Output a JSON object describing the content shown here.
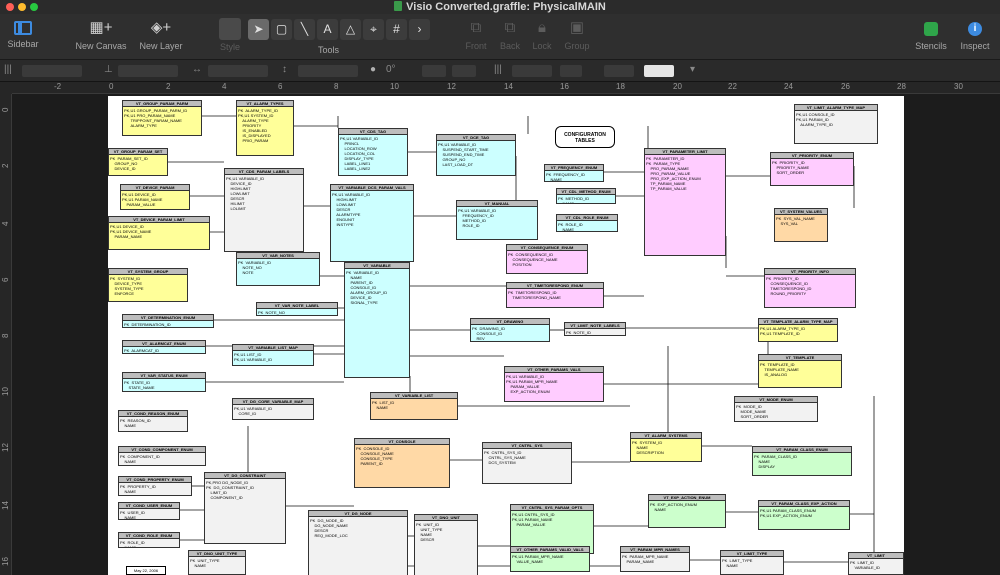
{
  "window": {
    "title": "Visio Converted.graffle: PhysicalMAIN"
  },
  "toolbar": {
    "sidebar": "Sidebar",
    "new_canvas": "New Canvas",
    "new_layer": "New Layer",
    "style": "Style",
    "tools": "Tools",
    "front": "Front",
    "back": "Back",
    "lock": "Lock",
    "group": "Group",
    "stencils": "Stencils",
    "inspect": "Inspect"
  },
  "formatbar": {
    "rotation": "0°"
  },
  "ruler": {
    "h_ticks": [
      "-2",
      "0",
      "2",
      "4",
      "6",
      "8",
      "10",
      "12",
      "14",
      "16",
      "18",
      "20",
      "22",
      "24",
      "26",
      "28",
      "30"
    ],
    "v_ticks": [
      "0",
      "2",
      "4",
      "6",
      "8",
      "10",
      "12",
      "14",
      "16"
    ]
  },
  "canvas": {
    "config_label": "CONFIGURATION TABLES",
    "date_label": "May 22, 2006",
    "tables": [
      {
        "name": "VT_GROUP_PARAM_PARM",
        "color": "yel",
        "rows": "PK,U1 GROUP_PARAM_PARM_ID\nPK,U1 PRO_PARAM_NAME\n      TRIPPOINT_PARAM_NAME\n      ALARM_TYPE"
      },
      {
        "name": "VT_ALARM_TYPES",
        "color": "yel",
        "rows": "PK  ALARM_TYPE_ID\nPK,U1 SYSTEM_ID\n    ALARM_TYPE\n    PRIORITY\n    IS_ENABLED\n    IS_DISPLAYED\n    PRIO_PARAM"
      },
      {
        "name": "VT_CDS_TAG",
        "color": "cyan",
        "rows": "PK,U1 VARIABLE_ID\n    PRINCL\n    LOCATION_ROW\n    LOCATION_COL\n    DISPLAY_TYPE\n    LABEL_LINE1\n    LABEL_LINE2"
      },
      {
        "name": "VT_DCE_TAG",
        "color": "cyan",
        "rows": "PK,U1 VARIABLE_ID\n    SUSPEND_START_TIME\n    SUSPEND_END_TIME\n    GROUP_NO\n    LAST_LOAD_DT"
      },
      {
        "name": "VT_GROUP_PARAM_SET",
        "color": "yel",
        "rows": "PK  PARAM_SET_ID\n    GROUP_NO\n    DEVICE_ID"
      },
      {
        "name": "VT_DEVICE_PARAM",
        "color": "yel",
        "rows": "PK,U1 DEVICE_ID\nPK,U1 PARAM_NAME\n    PARAM_VALUE"
      },
      {
        "name": "VT_CDS_PARAM_LABELS",
        "color": "grey",
        "rows": "PK,U1 VARIABLE_ID\n    DEVICE_ID\n    HIGHLIMIT\n    LOWLIMIT\n    DESCR\n    HILIMIT\n    LOLIMIT"
      },
      {
        "name": "VT_VARIABLE_DCS_PARAM_VALS",
        "color": "cyan",
        "rows": "PK,U1 VARIABLE_ID\n    HIGHLIMIT\n    LOWLIMIT\n    DESCR\n    ALARMTYPE\n    ENGUNIT\n    INSTYPE"
      },
      {
        "name": "VT_PARAMETER_LIMIT",
        "color": "mag",
        "rows": "PK  PARAMETER_ID\nPK  PARAM_TYPE\n    PRO_PARAM_NAME\n    PRO_PARAM_VALUE\n    PRO_EXP_ACTION_ENUM\n    TP_PARAM_NAME\n    TP_PARAM_VALUE"
      },
      {
        "name": "VT_FREQUENCY_ENUM",
        "color": "cyan",
        "rows": "PK  FREQUENCY_ID\n    NAME"
      },
      {
        "name": "VT_CDL_METHOD_ENUM",
        "color": "cyan",
        "rows": "PK  METHOD_ID\n    NAME"
      },
      {
        "name": "VT_MANUAL",
        "color": "cyan",
        "rows": "PK,U1 VARIABLE_ID\n    FREQUENCY_ID\n    METHOD_ID\n    ROLE_ID"
      },
      {
        "name": "VT_CDL_ROLE_ENUM",
        "color": "cyan",
        "rows": "PK  ROLE_ID\n    NAME"
      },
      {
        "name": "VT_PRIORITY_ENUM",
        "color": "mag",
        "rows": "PK  PRIORITY_ID\n    PRIORITY_NAME\n    SORT_ORDER"
      },
      {
        "name": "VT_LIMIT_ALARM_TYPE_MAP",
        "color": "grey",
        "rows": "PK,U1 CONSOLE_ID\nPK,U1 PARAM_ID\n    ALARM_TYPE_ID"
      },
      {
        "name": "VT_SYSTEM_VALUES",
        "color": "org",
        "rows": "PK  SYS_VAL_NAME\n    SYS_VAL"
      },
      {
        "name": "VT_DEVICE_PARAM_LIMIT",
        "color": "yel",
        "rows": "PK,U1 DEVICE_ID\nPK,U1 DEVICE_NAME\n    PARAM_NAME"
      },
      {
        "name": "VT_SYSTEM_GROUP",
        "color": "yel",
        "rows": "PK  SYSTEM_ID\n    DEVICE_TYPE\n    SYSTEM_TYPE\n    ENFORCE"
      },
      {
        "name": "VT_VAR_NOTES",
        "color": "cyan",
        "rows": "PK  VARIABLE_ID\n    NOTE_NO\n    NOTE"
      },
      {
        "name": "VT_VARIABLE",
        "color": "cyan",
        "rows": "PK  VARIABLE_ID\n    NAME\n    PARENT_ID\n    CONSOLE_ID\n    ALARM_GROUP_ID\n    DEVICE_ID\n    SIGNAL_TYPE"
      },
      {
        "name": "VT_CONSEQUENCE_ENUM",
        "color": "mag",
        "rows": "PK  CONSEQUENCE_ID\n    CONSEQUENCE_NAME\n    POSITION"
      },
      {
        "name": "VT_TIMETORESPOND_ENUM",
        "color": "mag",
        "rows": "PK  TIMETORESPOND_ID\n    TIMETORESPOND_NAME"
      },
      {
        "name": "VT_PRIORITY_INFO",
        "color": "mag",
        "rows": "PK  PRIORITY_ID\n    CONSEQUENCE_ID\n    TIMETORESPOND_ID\n    ROUND_PRIORITY"
      },
      {
        "name": "VT_DETERMINATION_ENUM",
        "color": "cyan",
        "rows": "PK  DETERMINATION_ID\n    DETERMINATION"
      },
      {
        "name": "VT_ALARMCAT_ENUM",
        "color": "cyan",
        "rows": "PK  ALARMCAT_ID\n    ALARMCAT"
      },
      {
        "name": "VT_VAR_STATUS_ENUM",
        "color": "cyan",
        "rows": "PK  STATE_ID\n    STATE_NAME"
      },
      {
        "name": "VT_VAR_NOTE_LABEL",
        "color": "cyan",
        "rows": "PK  NOTE_NO\n    NOTE_NAME"
      },
      {
        "name": "VT_VARIABLE_LIST_MAP",
        "color": "cyan",
        "rows": "PK,U1 LIST_ID\nPK,U1 VARIABLE_ID"
      },
      {
        "name": "VT_DRAWING",
        "color": "cyan",
        "rows": "PK  DRAWING_ID\n    CONSOLE_ID\n    REV"
      },
      {
        "name": "VT_LIMIT_NOTE_LABELS",
        "color": "grey",
        "rows": "PK  NOTE_ID\n    NOTE"
      },
      {
        "name": "VT_TEMPLATE_ALARM_TYPE_MAP",
        "color": "yel",
        "rows": "PK,U1 ALARM_TYPE_ID\nPK,U1 TEMPLATE_ID"
      },
      {
        "name": "VT_OTHER_PARAMS_VALS",
        "color": "mag",
        "rows": "PK,U1 VARIABLE_ID\nPK,U1 PARAM_MPR_NAME\n    PARAM_VALUE\n    EXP_ACTION_ENUM"
      },
      {
        "name": "VT_TEMPLATE",
        "color": "yel",
        "rows": "PK  TEMPLATE_ID\n    TEMPLATE_NAME\n    IS_ANALOG"
      },
      {
        "name": "VT_COND_REASON_ENUM",
        "color": "grey",
        "rows": "PK  REASON_ID\n    NAME"
      },
      {
        "name": "VT_DG_CORE_VARIABLE_MAP",
        "color": "grey",
        "rows": "PK,U1 VARIABLE_ID\n    CORE_ID"
      },
      {
        "name": "VT_VARIABLE_LIST",
        "color": "org",
        "rows": "PK  LIST_ID\n    NAME"
      },
      {
        "name": "VT_MODE_ENUM",
        "color": "grey",
        "rows": "PK  MODE_ID\n    MODE_NAME\n    SORT_ORDER"
      },
      {
        "name": "VT_COND_COMPONENT_ENUM",
        "color": "grey",
        "rows": "PK  COMPONENT_ID\n    NAME"
      },
      {
        "name": "VT_CONSOLE",
        "color": "org",
        "rows": "PK  CONSOLE_ID\n    CONSOLE_NAME\n    CONSOLE_TYPE\n    PARENT_ID"
      },
      {
        "name": "VT_CNTRL_SYS",
        "color": "grey",
        "rows": "PK  CNTRL_SYS_ID\n    CNTRL_SYS_NAME\n    DCS_SYSTEM"
      },
      {
        "name": "VT_ALARM_SYSTEMS",
        "color": "yel",
        "rows": "PK  SYSTEM_ID\n    NAME\n    DESCRIPTION"
      },
      {
        "name": "VT_PARAM_CLASS_ENUM",
        "color": "grn",
        "rows": "PK  PARAM_CLASS_ID\n    NAME\n    DISPLAY"
      },
      {
        "name": "VT_COND_PROPERTY_ENUM",
        "color": "grey",
        "rows": "PK  PROPERTY_ID\n    NAME"
      },
      {
        "name": "VT_DG_CONSTRAINT",
        "color": "grey",
        "rows": "PK,PRO DG_NODE_ID\nPK  DG_CONSTRAINT_ID\n    LIMIT_ID\n    COMPONENT_ID"
      },
      {
        "name": "VT_COND_USER_ENUM",
        "color": "grey",
        "rows": "PK  USER_ID\n    NAME"
      },
      {
        "name": "VT_COND_ROLE_ENUM",
        "color": "grey",
        "rows": "PK  ROLE_ID\n    NAME"
      },
      {
        "name": "VT_EXP_ACTION_ENUM",
        "color": "grn",
        "rows": "PK  EXP_ACTION_ENUM\n    NAME"
      },
      {
        "name": "VT_PARAM_CLASS_EXP_ACTION",
        "color": "grn",
        "rows": "PK,U1 PARAM_CLASS_ENUM\nPK,U1 EXP_ACTION_ENUM"
      },
      {
        "name": "VT_DG_NODE",
        "color": "grey",
        "rows": "PK  DG_NODE_ID\n    DG_NODE_NAME\n    DESCR\n    REQ_MODE_LOC"
      },
      {
        "name": "VT_DNO_UNIT",
        "color": "grey",
        "rows": "PK  UNIT_ID\n    UNIT_TYPE\n    NAME\n    DESCR"
      },
      {
        "name": "VT_CNTRL_SYS_PARAM_OPTS",
        "color": "grn",
        "rows": "PK,U1 CNTRL_SYS_ID\nPK,U1 PARAM_NAME\n    PARAM_VALUE"
      },
      {
        "name": "VT_OTHER_PARAMS_VALID_VALS",
        "color": "grn",
        "rows": "PK,U1 PARAM_MPR_NAME\n    VALUE_NAME"
      },
      {
        "name": "VT_PARAM_MPR_NAMES",
        "color": "grey",
        "rows": "PK  PARAM_MPR_NAME\n    PARAM_NAME"
      },
      {
        "name": "VT_LIMIT_TYPE",
        "color": "grey",
        "rows": "PK  LIMIT_TYPE\n    NAME"
      },
      {
        "name": "VT_LIMIT",
        "color": "grey",
        "rows": "PK  LIMIT_ID\n    VARIABLE_ID"
      },
      {
        "name": "VT_DNO_UNIT_TYPE",
        "color": "grey",
        "rows": "PK  UNIT_TYPE\n    NAME"
      }
    ]
  }
}
